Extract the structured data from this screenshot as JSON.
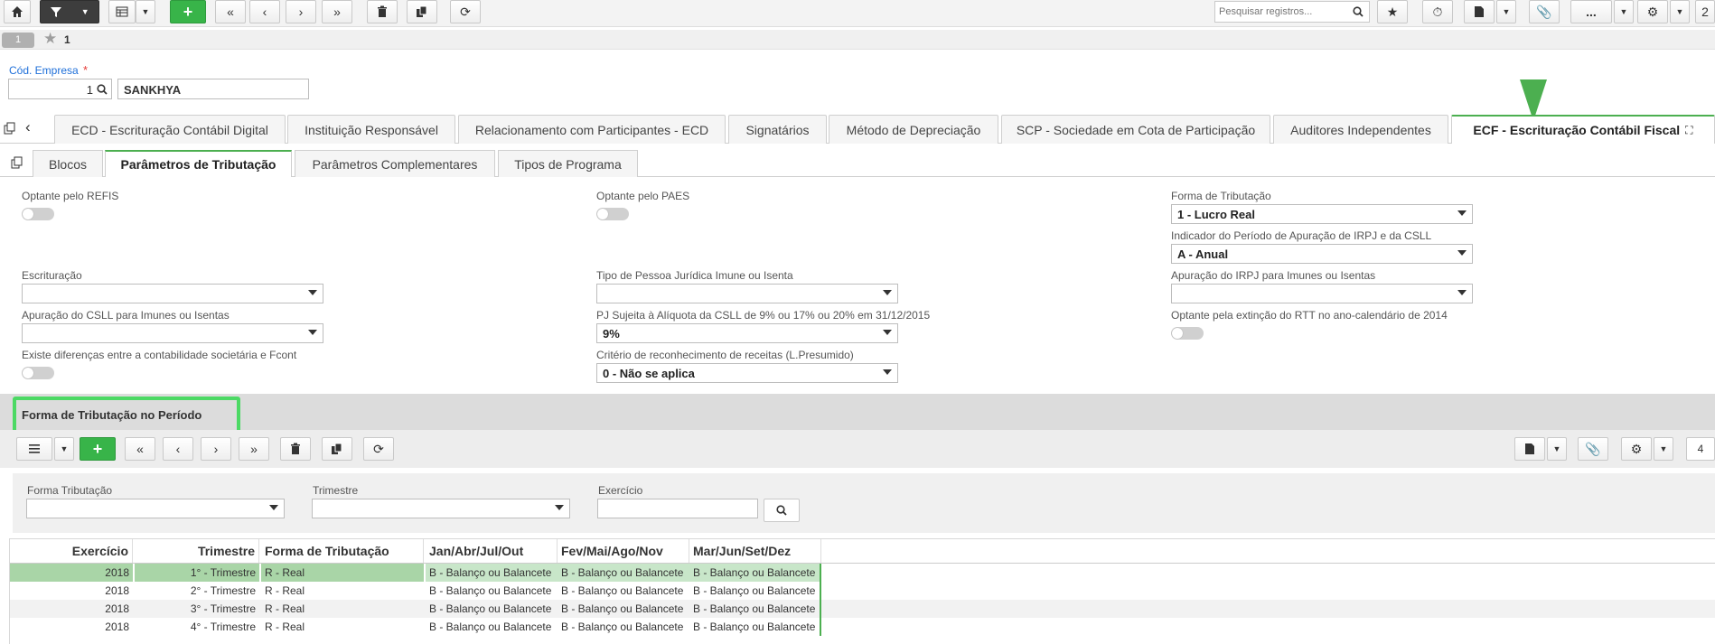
{
  "toolbar": {
    "search_placeholder": "Pesquisar registros...",
    "more": "...",
    "right_edge": "2"
  },
  "record_bar": {
    "number": "1",
    "star_count": "1"
  },
  "company": {
    "label": "Cód. Empresa",
    "required": "*",
    "code": "1",
    "name": "SANKHYA"
  },
  "tabs": [
    "ECD - Escrituração Contábil Digital",
    "Instituição Responsável",
    "Relacionamento com Participantes - ECD",
    "Signatários",
    "Método de Depreciação",
    "SCP - Sociedade em Cota de Participação",
    "Auditores Independentes",
    "ECF - Escrituração Contábil Fiscal"
  ],
  "subtabs": [
    "Blocos",
    "Parâmetros de Tributação",
    "Parâmetros Complementares",
    "Tipos de Programa"
  ],
  "form": {
    "refis": "Optante pelo REFIS",
    "paes": "Optante pelo PAES",
    "forma_tributacao_label": "Forma de Tributação",
    "forma_tributacao_value": "1 - Lucro Real",
    "indicador_label": "Indicador do Período de Apuração de IRPJ e da CSLL",
    "indicador_value": "A - Anual",
    "escrituracao": "Escrituração",
    "tipo_pj": "Tipo de Pessoa Jurídica Imune ou Isenta",
    "apuracao_irpj": "Apuração do IRPJ para Imunes ou Isentas",
    "apuracao_csll": "Apuração do CSLL para Imunes ou Isentas",
    "pj_aliquota_label": "PJ Sujeita à Alíquota da CSLL de 9% ou 17% ou 20% em 31/12/2015",
    "pj_aliquota_value": "9%",
    "rtt": "Optante pela extinção do RTT no ano-calendário de 2014",
    "diferencas": "Existe diferenças entre a contabilidade societária e Fcont",
    "criterio_label": "Critério de reconhecimento de receitas (L.Presumido)",
    "criterio_value": "0 - Não se aplica"
  },
  "section": {
    "title": "Forma de Tributação no Período",
    "page_count": "4",
    "filter_forma": "Forma Tributação",
    "filter_trimestre": "Trimestre",
    "filter_exercicio": "Exercício"
  },
  "grid": {
    "columns": [
      "Exercício",
      "Trimestre",
      "Forma de Tributação",
      "Jan/Abr/Jul/Out",
      "Fev/Mai/Ago/Nov",
      "Mar/Jun/Set/Dez"
    ],
    "rows": [
      [
        "2018",
        "1° - Trimestre",
        "R - Real",
        "B - Balanço ou Balancete",
        "B - Balanço ou Balancete",
        "B - Balanço ou Balancete"
      ],
      [
        "2018",
        "2° - Trimestre",
        "R - Real",
        "B - Balanço ou Balancete",
        "B - Balanço ou Balancete",
        "B - Balanço ou Balancete"
      ],
      [
        "2018",
        "3° - Trimestre",
        "R - Real",
        "B - Balanço ou Balancete",
        "B - Balanço ou Balancete",
        "B - Balanço ou Balancete"
      ],
      [
        "2018",
        "4° - Trimestre",
        "R - Real",
        "B - Balanço ou Balancete",
        "B - Balanço ou Balancete",
        "B - Balanço ou Balancete"
      ]
    ]
  }
}
